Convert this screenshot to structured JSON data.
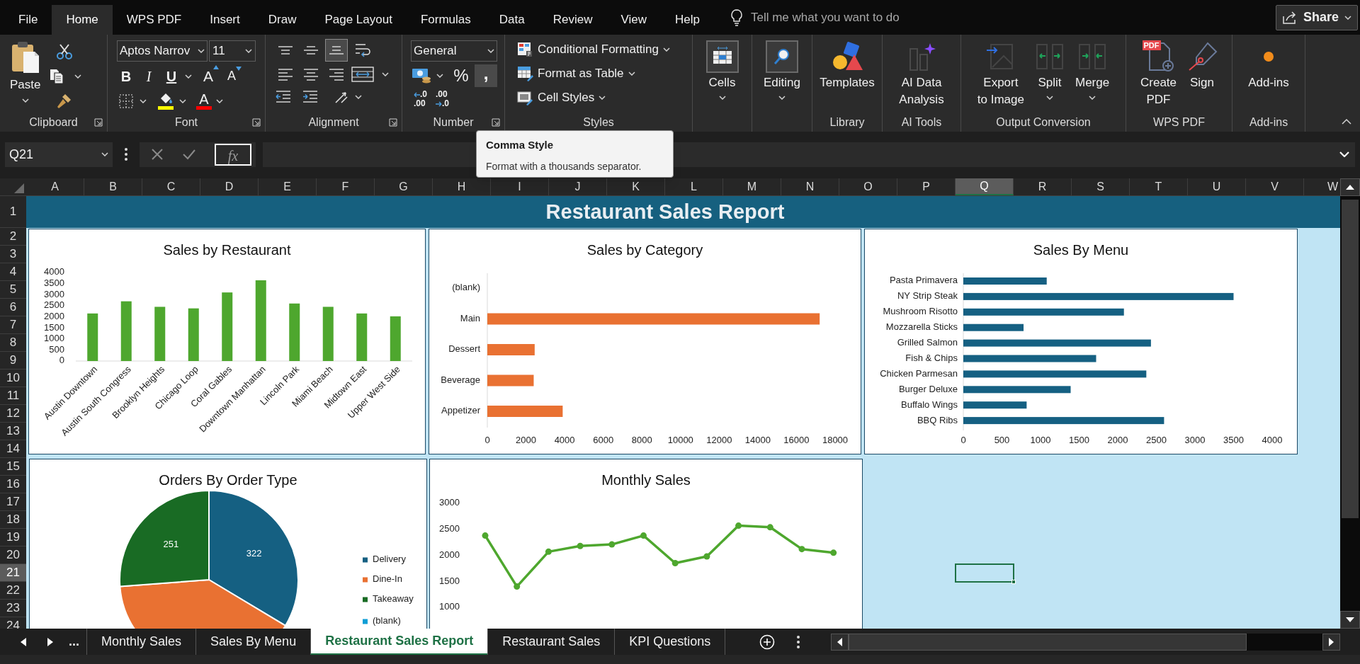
{
  "menu_tabs": [
    {
      "label": "File",
      "selected": false
    },
    {
      "label": "Home",
      "selected": true
    },
    {
      "label": "WPS PDF",
      "selected": false
    },
    {
      "label": "Insert",
      "selected": false
    },
    {
      "label": "Draw",
      "selected": false
    },
    {
      "label": "Page Layout",
      "selected": false
    },
    {
      "label": "Formulas",
      "selected": false
    },
    {
      "label": "Data",
      "selected": false
    },
    {
      "label": "Review",
      "selected": false
    },
    {
      "label": "View",
      "selected": false
    },
    {
      "label": "Help",
      "selected": false
    }
  ],
  "search": {
    "placeholder": "Tell me what you want to do"
  },
  "share_button": "Share",
  "ribbon": [
    {
      "kind": "clipboard",
      "label": "Clipboard",
      "launcher": true,
      "paste": "Paste"
    },
    {
      "kind": "font",
      "label": "Font",
      "launcher": true,
      "font_name": "Aptos Narrov",
      "font_size": "11",
      "bold": "B",
      "italic": "I",
      "underline": "U",
      "grow": "A",
      "shrink": "A",
      "font_color": "A"
    },
    {
      "kind": "alignment",
      "label": "Alignment",
      "launcher": true,
      "vertical": [
        {
          "selected": false
        },
        {
          "selected": false
        },
        {
          "selected": true
        }
      ],
      "horizontal": [
        {
          "selected": false
        },
        {
          "selected": false
        },
        {
          "selected": false
        }
      ]
    },
    {
      "kind": "number",
      "label": "Number",
      "launcher": true,
      "format": "General",
      "percent": "%",
      "comma": ",",
      "comma_highlighted": true,
      "increase_decimal": [
        ".0",
        ".00"
      ],
      "decrease_decimal": [
        ".00",
        ".0"
      ]
    },
    {
      "kind": "styles",
      "label": "Styles",
      "items": [
        {
          "label": "Conditional Formatting"
        },
        {
          "label": "Format as Table"
        },
        {
          "label": "Cell Styles"
        }
      ]
    },
    {
      "kind": "buttons",
      "buttons": [
        {
          "label": "Cells",
          "menu": true
        }
      ]
    },
    {
      "kind": "buttons",
      "buttons": [
        {
          "label": "Editing",
          "menu": true
        }
      ]
    },
    {
      "kind": "buttons",
      "label": "Library",
      "buttons": [
        {
          "label": "Templates"
        }
      ]
    },
    {
      "kind": "buttons",
      "label": "AI Tools",
      "buttons": [
        {
          "label": "AI Data\nAnalysis"
        }
      ]
    },
    {
      "kind": "buttons",
      "label": "Output Conversion",
      "buttons": [
        {
          "label": "Export\nto Image"
        },
        {
          "label": "Split",
          "menu": true
        },
        {
          "label": "Merge",
          "menu": true
        }
      ]
    },
    {
      "kind": "buttons",
      "label": "WPS PDF",
      "buttons": [
        {
          "badge": "PDF",
          "label": "Create\nPDF"
        },
        {
          "label": "Sign"
        }
      ]
    },
    {
      "kind": "buttons",
      "label": "Add-ins",
      "buttons": [
        {
          "label": "Add-ins"
        }
      ]
    }
  ],
  "formula_bar": {
    "name_box": "Q21",
    "fx": "fx"
  },
  "tooltip": {
    "title": "Comma Style",
    "text": "Format with a thousands separator."
  },
  "columns": [
    {
      "label": "A",
      "selected": false
    },
    {
      "label": "B",
      "selected": false
    },
    {
      "label": "C",
      "selected": false
    },
    {
      "label": "D",
      "selected": false
    },
    {
      "label": "E",
      "selected": false
    },
    {
      "label": "F",
      "selected": false
    },
    {
      "label": "G",
      "selected": false
    },
    {
      "label": "H",
      "selected": false
    },
    {
      "label": "I",
      "selected": false
    },
    {
      "label": "J",
      "selected": false
    },
    {
      "label": "K",
      "selected": false
    },
    {
      "label": "L",
      "selected": false
    },
    {
      "label": "M",
      "selected": false
    },
    {
      "label": "N",
      "selected": false
    },
    {
      "label": "O",
      "selected": false
    },
    {
      "label": "P",
      "selected": false
    },
    {
      "label": "Q",
      "selected": true
    },
    {
      "label": "R",
      "selected": false
    },
    {
      "label": "S",
      "selected": false
    },
    {
      "label": "T",
      "selected": false
    },
    {
      "label": "U",
      "selected": false
    },
    {
      "label": "V",
      "selected": false
    },
    {
      "label": "W",
      "selected": false
    }
  ],
  "rows": [
    {
      "label": "1",
      "selected": false
    },
    {
      "label": "2",
      "selected": false
    },
    {
      "label": "3",
      "selected": false
    },
    {
      "label": "4",
      "selected": false
    },
    {
      "label": "5",
      "selected": false
    },
    {
      "label": "6",
      "selected": false
    },
    {
      "label": "7",
      "selected": false
    },
    {
      "label": "8",
      "selected": false
    },
    {
      "label": "9",
      "selected": false
    },
    {
      "label": "10",
      "selected": false
    },
    {
      "label": "11",
      "selected": false
    },
    {
      "label": "12",
      "selected": false
    },
    {
      "label": "13",
      "selected": false
    },
    {
      "label": "14",
      "selected": false
    },
    {
      "label": "15",
      "selected": false
    },
    {
      "label": "16",
      "selected": false
    },
    {
      "label": "17",
      "selected": false
    },
    {
      "label": "18",
      "selected": false
    },
    {
      "label": "19",
      "selected": false
    },
    {
      "label": "20",
      "selected": false
    },
    {
      "label": "21",
      "selected": true
    },
    {
      "label": "22",
      "selected": false
    },
    {
      "label": "23",
      "selected": false
    },
    {
      "label": "24",
      "selected": false
    }
  ],
  "report_title": "Restaurant Sales Report",
  "charts": [
    {
      "chart_data": {
        "type": "bar",
        "title": "Sales by Restaurant",
        "categories": [
          "Austin Downtown",
          "Austin South Congress",
          "Brooklyn Heights",
          "Chicago Loop",
          "Coral Gables",
          "Downtown Manhattan",
          "Lincoln Park",
          "Miami Beach",
          "Midtown East",
          "Upper West Side"
        ],
        "series": [
          {
            "color": "#4ea72e",
            "values": [
              2150,
              2700,
              2450,
              2380,
              3100,
              3650,
              2600,
              2450,
              2150,
              2020
            ]
          }
        ],
        "ylim": [
          0,
          4000
        ],
        "yticks": [
          0,
          500,
          1000,
          1500,
          2000,
          2500,
          3000,
          3500,
          4000
        ]
      }
    },
    {
      "chart_data": {
        "type": "bar",
        "orientation": "horizontal",
        "title": "Sales by Category",
        "categories": [
          "(blank)",
          "Main",
          "Dessert",
          "Beverage",
          "Appetizer"
        ],
        "series": [
          {
            "color": "#e97132",
            "values": [
              null,
              17200,
              2450,
              2400,
              3900
            ]
          }
        ],
        "xlim": [
          0,
          18000
        ],
        "xticks": [
          0,
          2000,
          4000,
          6000,
          8000,
          10000,
          12000,
          14000,
          16000,
          18000
        ]
      }
    },
    {
      "chart_data": {
        "type": "bar",
        "orientation": "horizontal",
        "title": "Sales By Menu",
        "categories": [
          "Pasta Primavera",
          "NY Strip Steak",
          "Mushroom Risotto",
          "Mozzarella Sticks",
          "Grilled Salmon",
          "Fish & Chips",
          "Chicken Parmesan",
          "Burger Deluxe",
          "Buffalo Wings",
          "BBQ Ribs"
        ],
        "series": [
          {
            "color": "#156082",
            "values": [
              1080,
              3500,
              2080,
              780,
              2430,
              1720,
              2370,
              1390,
              820,
              2600
            ]
          }
        ],
        "xlim": [
          0,
          4000
        ],
        "xticks": [
          0,
          500,
          1000,
          1500,
          2000,
          2500,
          3000,
          3500,
          4000
        ]
      }
    },
    {
      "chart_data": {
        "type": "pie",
        "title": "Orders By Order Type",
        "categories": [
          "Delivery",
          "Dine-In",
          "Takeaway",
          "(blank)"
        ],
        "colors": [
          "#156082",
          "#e97132",
          "#196b24",
          "#0f9ed5"
        ],
        "legend": true,
        "series": [
          {
            "values": [
              33.6,
              40.2,
              26.2,
              0
            ]
          }
        ],
        "value_labels": [
          "322",
          null,
          "251",
          null
        ]
      }
    },
    {
      "chart_data": {
        "type": "line",
        "title": "Monthly Sales",
        "series": [
          {
            "color": "#4ea72e",
            "marker": "circle",
            "values": [
              2380,
              1400,
              2070,
              2180,
              2210,
              2380,
              1850,
              1980,
              2570,
              2540,
              2120,
              2050
            ]
          }
        ],
        "ylim": [
          1000,
          3000
        ],
        "yticks": [
          1000,
          1500,
          2000,
          2500,
          3000
        ]
      }
    }
  ],
  "sheet_tabs": {
    "more": "...",
    "tabs": [
      {
        "label": "Monthly Sales",
        "selected": false
      },
      {
        "label": "Sales By Menu",
        "selected": false
      },
      {
        "label": "Restaurant Sales Report",
        "selected": true
      },
      {
        "label": "Restaurant Sales",
        "selected": false
      },
      {
        "label": "KPI Questions",
        "selected": false
      }
    ]
  }
}
